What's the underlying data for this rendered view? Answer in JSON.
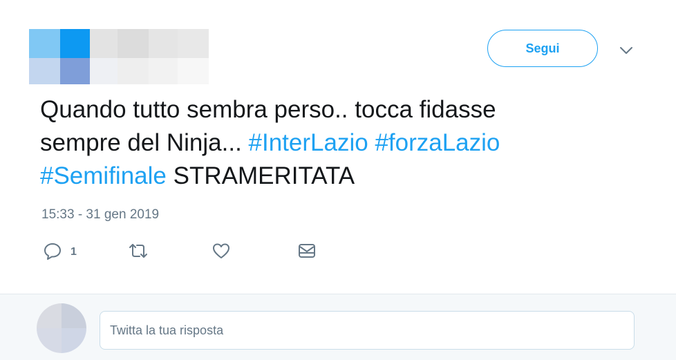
{
  "user": {
    "avatar_colors": [
      "#80c8f4",
      "#0d99f2",
      "#e3e3e3",
      "#dcdcdc",
      "#e5e5e5",
      "#e8e8e8",
      "#c3d6ef",
      "#7f9ed9",
      "#eef0f4",
      "#eeeeee",
      "#f2f2f2",
      "#f7f7f7"
    ]
  },
  "header": {
    "follow_label": "Segui",
    "menu_icon": "chevron-down-icon"
  },
  "tweet": {
    "line1_text": "Quando tutto sembra perso.. tocca fidasse",
    "line2_text": "sempre del Ninja... ",
    "hashtag1": "#InterLazio",
    "hashtag2": "#forzaLazio",
    "hashtag3": "#Semifinale",
    "line3_text": " STRAMERITATA",
    "timestamp": "15:33 - 31 gen 2019"
  },
  "actions": {
    "reply_icon": "reply-icon",
    "reply_count": "1",
    "retweet_icon": "retweet-icon",
    "like_icon": "heart-icon",
    "dm_icon": "envelope-icon"
  },
  "reply_box": {
    "placeholder": "Twitta la tua risposta",
    "avatar_colors": [
      "#d9dbe2",
      "#c9cfdc",
      "#d6dae6",
      "#cfd6e6"
    ]
  },
  "colors": {
    "accent": "#1da1f2",
    "text": "#14171a",
    "muted": "#657786",
    "reply_bg": "#f5f8fa"
  }
}
